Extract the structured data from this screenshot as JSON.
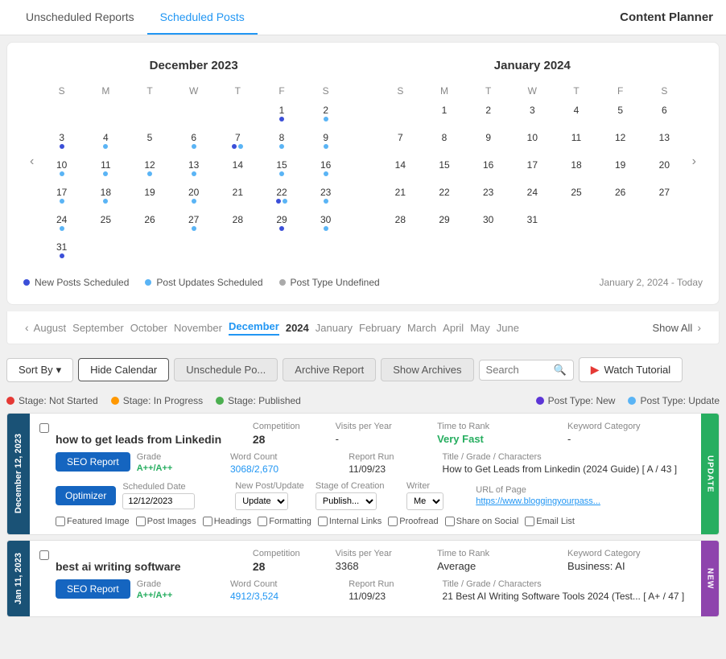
{
  "tabs": {
    "unscheduled": "Unscheduled Reports",
    "scheduled": "Scheduled Posts",
    "content_planner": "Content Planner"
  },
  "calendar": {
    "prev_btn": "‹",
    "next_btn": "›",
    "december": {
      "title": "December 2023",
      "days": [
        "S",
        "M",
        "T",
        "W",
        "T",
        "F",
        "S"
      ],
      "weeks": [
        [
          null,
          null,
          null,
          null,
          null,
          {
            "n": 1,
            "dots": [
              "blue"
            ]
          },
          {
            "n": 2,
            "dots": [
              "lightblue"
            ]
          }
        ],
        [
          {
            "n": 3,
            "dots": [
              "blue"
            ]
          },
          {
            "n": 4,
            "dots": [
              "lightblue"
            ]
          },
          {
            "n": 5,
            "dots": []
          },
          {
            "n": 6,
            "dots": [
              "lightblue"
            ]
          },
          {
            "n": 7,
            "dots": [
              "blue",
              "lightblue"
            ]
          },
          {
            "n": 8,
            "dots": [
              "lightblue"
            ]
          },
          {
            "n": 9,
            "dots": [
              "lightblue"
            ]
          }
        ],
        [
          {
            "n": 10,
            "dots": [
              "lightblue"
            ]
          },
          {
            "n": 11,
            "dots": [
              "lightblue"
            ]
          },
          {
            "n": 12,
            "dots": [
              "lightblue"
            ]
          },
          {
            "n": 13,
            "dots": [
              "lightblue"
            ]
          },
          {
            "n": 14,
            "dots": []
          },
          {
            "n": 15,
            "dots": [
              "lightblue"
            ]
          },
          {
            "n": 16,
            "dots": [
              "lightblue"
            ]
          }
        ],
        [
          {
            "n": 17,
            "dots": [
              "lightblue"
            ]
          },
          {
            "n": 18,
            "dots": [
              "lightblue"
            ]
          },
          {
            "n": 19,
            "dots": []
          },
          {
            "n": 20,
            "dots": [
              "lightblue"
            ]
          },
          {
            "n": 21,
            "dots": []
          },
          {
            "n": 22,
            "dots": [
              "blue",
              "lightblue"
            ]
          },
          {
            "n": 23,
            "dots": [
              "lightblue"
            ]
          }
        ],
        [
          {
            "n": 24,
            "dots": [
              "lightblue"
            ]
          },
          {
            "n": 25,
            "dots": []
          },
          {
            "n": 26,
            "dots": []
          },
          {
            "n": 27,
            "dots": [
              "lightblue"
            ]
          },
          {
            "n": 28,
            "dots": []
          },
          {
            "n": 29,
            "dots": [
              "blue"
            ]
          },
          {
            "n": 30,
            "dots": [
              "lightblue"
            ]
          }
        ],
        [
          {
            "n": 31,
            "dots": [
              "blue"
            ]
          },
          null,
          null,
          null,
          null,
          null,
          null
        ]
      ]
    },
    "january": {
      "title": "January 2024",
      "days": [
        "S",
        "M",
        "T",
        "W",
        "T",
        "F",
        "S"
      ],
      "weeks": [
        [
          null,
          {
            "n": 1,
            "dots": []
          },
          {
            "n": 2,
            "dots": []
          },
          {
            "n": 3,
            "dots": []
          },
          {
            "n": 4,
            "dots": []
          },
          {
            "n": 5,
            "dots": []
          },
          {
            "n": 6,
            "dots": []
          }
        ],
        [
          {
            "n": 7,
            "dots": []
          },
          {
            "n": 8,
            "dots": []
          },
          {
            "n": 9,
            "dots": []
          },
          {
            "n": 10,
            "dots": []
          },
          {
            "n": 11,
            "dots": []
          },
          {
            "n": 12,
            "dots": []
          },
          {
            "n": 13,
            "dots": []
          }
        ],
        [
          {
            "n": 14,
            "dots": []
          },
          {
            "n": 15,
            "dots": []
          },
          {
            "n": 16,
            "dots": []
          },
          {
            "n": 17,
            "dots": []
          },
          {
            "n": 18,
            "dots": []
          },
          {
            "n": 19,
            "dots": []
          },
          {
            "n": 20,
            "dots": []
          }
        ],
        [
          {
            "n": 21,
            "dots": []
          },
          {
            "n": 22,
            "dots": []
          },
          {
            "n": 23,
            "dots": []
          },
          {
            "n": 24,
            "dots": []
          },
          {
            "n": 25,
            "dots": []
          },
          {
            "n": 26,
            "dots": []
          },
          {
            "n": 27,
            "dots": []
          }
        ],
        [
          {
            "n": 28,
            "dots": []
          },
          {
            "n": 29,
            "dots": []
          },
          {
            "n": 30,
            "dots": []
          },
          {
            "n": 31,
            "dots": []
          },
          null,
          null,
          null
        ]
      ]
    },
    "legend": {
      "new_posts": "New Posts Scheduled",
      "updates": "Post Updates Scheduled",
      "undefined": "Post Type Undefined"
    },
    "date_range": "January 2, 2024 - Today"
  },
  "month_nav": {
    "prev": "‹",
    "next": "›",
    "months": [
      "August",
      "September",
      "October",
      "November",
      "December",
      "2024",
      "January",
      "February",
      "March",
      "April",
      "May",
      "June"
    ],
    "active": "December",
    "show_all": "Show All"
  },
  "toolbar": {
    "sort_by": "Sort By",
    "hide_calendar": "Hide Calendar",
    "unschedule_post": "Unschedule Po...",
    "archive_report": "Archive Report",
    "show_archives": "Show Archives",
    "search_placeholder": "Search",
    "watch_tutorial": "Watch Tutorial"
  },
  "stage_legend": {
    "not_started": "Stage: Not Started",
    "in_progress": "Stage: In Progress",
    "published": "Stage: Published",
    "post_type_new": "Post Type: New",
    "post_type_update": "Post Type: Update"
  },
  "card1": {
    "date_label": "December 12, 2023",
    "keyword": "how to get leads from Linkedin",
    "competition_label": "Competition",
    "competition": "28",
    "visits_label": "Visits per Year",
    "visits": "-",
    "time_to_rank_label": "Time to Rank",
    "time_to_rank": "Very Fast",
    "category_label": "Keyword Category",
    "category": "-",
    "seo_btn": "SEO Report",
    "optimizer_btn": "Optimizer",
    "grade_label": "Grade",
    "grade": "A++/A++",
    "word_count_label": "Word Count",
    "word_count": "3068/2,670",
    "report_run_label": "Report Run",
    "report_run": "11/09/23",
    "title_label": "Title / Grade / Characters",
    "title": "How to Get Leads from Linkedin (2024 Guide) [ A / 43 ]",
    "scheduled_date_label": "Scheduled Date",
    "scheduled_date": "12/12/2023",
    "new_post_label": "New Post/Update",
    "new_post": "Update",
    "stage_label": "Stage of Creation",
    "stage": "Publish...",
    "writer_label": "Writer",
    "writer": "Me",
    "url_label": "URL of Page",
    "url": "https://www.bloggingyourpass...",
    "checkboxes": [
      "Featured Image",
      "Post Images",
      "Headings",
      "Formatting",
      "Internal Links",
      "Proofread",
      "Share on Social",
      "Email List"
    ],
    "badge": "UPDATE"
  },
  "card2": {
    "date_label": "Jan 11, 2023",
    "keyword": "best ai writing software",
    "competition_label": "Competition",
    "competition": "28",
    "visits_label": "Visits per Year",
    "visits": "3368",
    "time_to_rank_label": "Time to Rank",
    "time_to_rank": "Average",
    "category_label": "Keyword Category",
    "category": "Business: AI",
    "seo_btn": "SEO Report",
    "grade_label": "Grade",
    "grade": "A++/A++",
    "word_count_label": "Word Count",
    "word_count": "4912/3,524",
    "report_run_label": "Report Run",
    "report_run": "11/09/23",
    "title_label": "Title / Grade / Characters",
    "title": "21 Best AI Writing Software Tools 2024 (Test... [ A+ / 47 ]",
    "badge": "NEW"
  }
}
